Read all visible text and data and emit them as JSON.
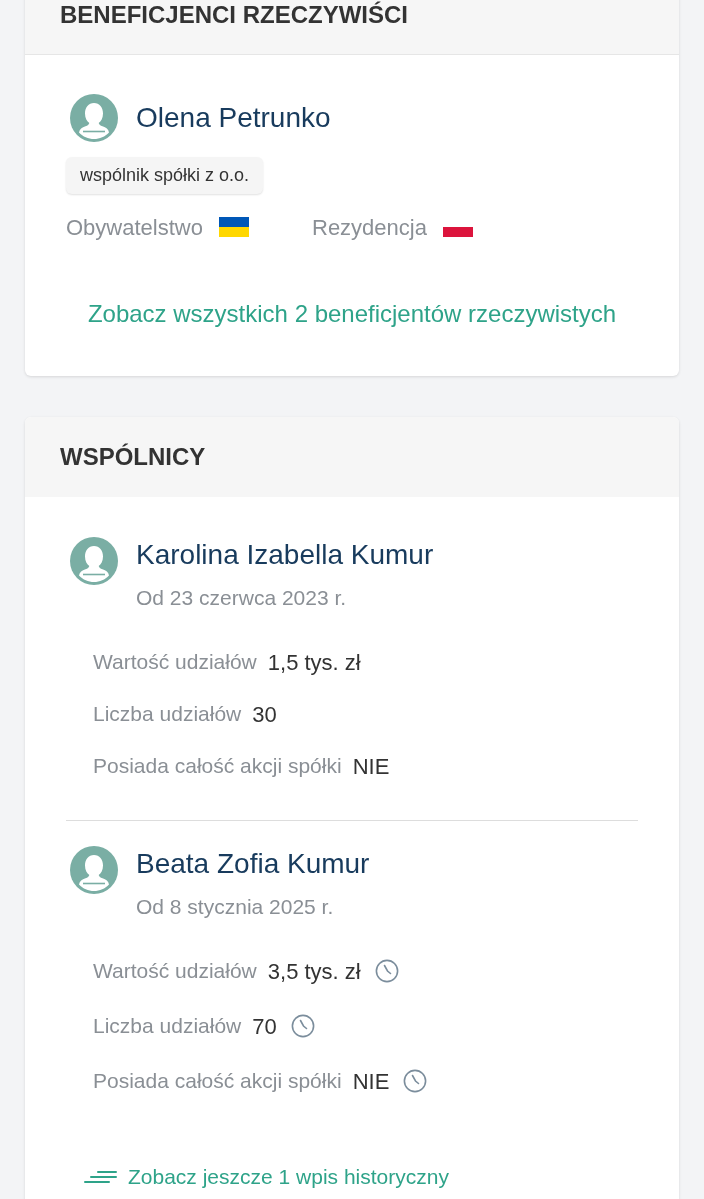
{
  "beneficial_owners": {
    "title": "BENEFICJENCI RZECZYWIŚCI",
    "people": [
      {
        "name": "Olena Petrunko",
        "role": "wspólnik spółki z o.o.",
        "citizenship": {
          "label": "Obywatelstwo",
          "kind": "ukraine"
        },
        "residence": {
          "label": "Rezydencja",
          "kind": "poland"
        }
      }
    ],
    "link": "Zobacz wszystkich 2 beneficjentów rzeczywistych"
  },
  "partners": {
    "title": "WSPÓLNICY",
    "people": [
      {
        "name": "Karolina Izabella Kumur",
        "since": "Od 23 czerwca 2023 r.",
        "fields": [
          {
            "label": "Wartość udziałów",
            "value": "1,5 tys. zł",
            "history": false
          },
          {
            "label": "Liczba udziałów",
            "value": "30",
            "history": false
          },
          {
            "label": "Posiada całość akcji spółki",
            "value": "NIE",
            "history": false
          }
        ]
      },
      {
        "name": "Beata Zofia Kumur",
        "since": "Od 8 stycznia 2025 r.",
        "fields": [
          {
            "label": "Wartość udziałów",
            "value": "3,5 tys. zł",
            "history": true
          },
          {
            "label": "Liczba udziałów",
            "value": "70",
            "history": true
          },
          {
            "label": "Posiada całość akcji spółki",
            "value": "NIE",
            "history": true
          }
        ]
      }
    ],
    "history_link": "Zobacz jeszcze 1 wpis historyczny"
  }
}
